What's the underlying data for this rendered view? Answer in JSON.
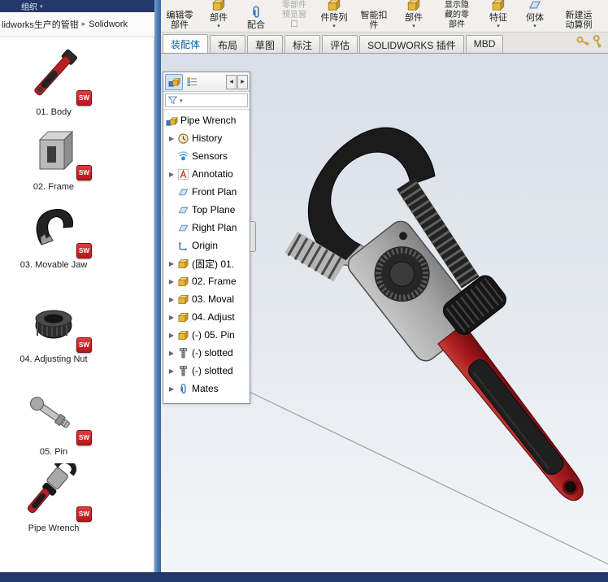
{
  "colors": {
    "bar_blue": "#24386b",
    "sw_badge_red": "#cf1f26",
    "wrench_red": "#b01b1b",
    "active_tab_text": "#1464a0"
  },
  "icons": {
    "dropdown_caret": "▾",
    "expander": "▶",
    "breadcrumb_separator": "▸",
    "collapse_left": "◀",
    "collapse_right": "▶",
    "organize_caret": "▾"
  },
  "explorer": {
    "menubar": {
      "organize_label": "组织"
    },
    "breadcrumb": {
      "parent": "lidworks生产的管钳",
      "current": "Solidwork"
    },
    "badge_text": "SW",
    "files": [
      {
        "caption": "01. Body"
      },
      {
        "caption": "02. Frame"
      },
      {
        "caption": "03. Movable Jaw"
      },
      {
        "caption": "04. Adjusting Nut"
      },
      {
        "caption": "05. Pin"
      },
      {
        "caption": "Pipe Wrench"
      }
    ]
  },
  "ribbon": {
    "buttons": [
      {
        "lines": [
          "编辑零",
          "部件"
        ]
      },
      {
        "lines": [
          "部件"
        ],
        "caret": "▾"
      },
      {
        "lines": [
          "配合"
        ]
      },
      {
        "lines": [
          "零部件",
          "预览窗",
          "口"
        ],
        "disabled": true
      },
      {
        "lines": [
          "件阵列"
        ],
        "caret": "▾"
      },
      {
        "lines": [
          "智能扣",
          "件"
        ]
      },
      {
        "lines": [
          "部件"
        ],
        "caret": "▾"
      },
      {
        "lines": [
          "显示隐",
          "藏的零",
          "部件"
        ]
      },
      {
        "lines": [
          "特征"
        ],
        "caret": "▾"
      },
      {
        "lines": [
          "何体"
        ],
        "caret": "▾"
      },
      {
        "lines": [
          "新建运",
          "动算例"
        ]
      }
    ]
  },
  "tabs": {
    "items": [
      "装配体",
      "布局",
      "草图",
      "标注",
      "评估",
      "SOLIDWORKS 插件",
      "MBD"
    ],
    "active_index": 0
  },
  "feature_manager": {
    "tree": [
      {
        "label": "Pipe Wrench"
      },
      {
        "label": "History"
      },
      {
        "label": "Sensors"
      },
      {
        "label": "Annotatio"
      },
      {
        "label": "Front Plan"
      },
      {
        "label": "Top Plane"
      },
      {
        "label": "Right Plan"
      },
      {
        "label": "Origin"
      },
      {
        "label": "(固定) 01."
      },
      {
        "label": "02. Frame"
      },
      {
        "label": "03. Moval"
      },
      {
        "label": "04. Adjust"
      },
      {
        "label": "(-) 05. Pin"
      },
      {
        "label": "(-) slotted"
      },
      {
        "label": "(-) slotted"
      },
      {
        "label": "Mates"
      }
    ]
  }
}
